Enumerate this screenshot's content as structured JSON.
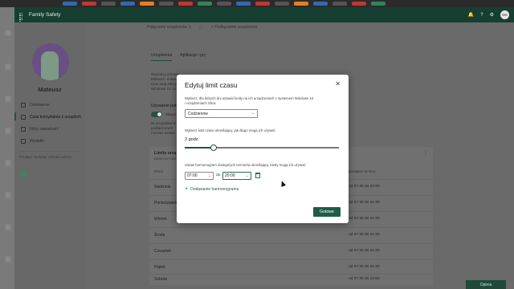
{
  "app": {
    "title": "Family Safety",
    "user_initials": "MS",
    "help_icon": "help-icon",
    "settings_icon": "settings-icon"
  },
  "top_links": {
    "connected": "Połączone urządzenia: 1",
    "connect_device": "+ Podłączanie urządzenia"
  },
  "sidebar": {
    "name": "Mateusz",
    "items": [
      {
        "label": "Omówienie",
        "icon": "overview-icon"
      },
      {
        "label": "Czas korzystania z urządzeń",
        "icon": "screen-time-icon"
      },
      {
        "label": "Filtry zawartości",
        "icon": "filter-icon"
      },
      {
        "label": "Wydatki",
        "icon": "spending-icon"
      }
    ],
    "note": "Przyłącz na swoje członka rodziny"
  },
  "tabs": [
    "Urządzenia",
    "Aplikacje i gry"
  ],
  "background_text": {
    "p1": "Wypracuj zdrowe\nMateusz. Zobacz\nczas tutaj zdecyd\nWindows 10 i ko",
    "using_one": "Używanie jednego",
    "toggle_label": "Włączone",
    "p2": "W przypadku w\npodłączonych\nmożesz ustawi"
  },
  "limits_card": {
    "title": "Limity urzą",
    "subtitle": "DESKTOP-0ZZ",
    "col_day": "Dzień",
    "col_avail": "Dostępne terminy",
    "rows": [
      {
        "day": "Niedziela",
        "range": "od 07:30 do 22:00"
      },
      {
        "day": "Poniedziałek",
        "range": "od 07:30 do 21:30"
      },
      {
        "day": "Wtorek",
        "range": "od 07:30 do 21:30"
      },
      {
        "day": "Środa",
        "range": "od 07:30 do 21:30"
      },
      {
        "day": "Czwartek",
        "range": "od 07:30 do 21:30"
      },
      {
        "day": "Piątek",
        "range": "od 07:30 do 21:30"
      },
      {
        "day": "Sobota",
        "range": "od 07:30 do 22:00"
      }
    ]
  },
  "feedback_button": "Opinia",
  "modal": {
    "title": "Edytuj limit czasu",
    "desc_days": "Wybierz, dla których dni ustawić limity na ich urządzeniach z systemem Windows 10\ni urządzeniach Xbox",
    "days_select": "Codziennie",
    "desc_duration": "Wybierz limit czasu określający, jak długo mogą ich używać",
    "duration": "2 godz.",
    "duration_fraction": 0.19,
    "desc_schedule": "Ustaw harmonogram dostępnych terminów określający, kiedy mogą ich używać",
    "from_time": "07:00",
    "to_label": "do",
    "to_time": "20:00",
    "add_schedule": "Dodawanie harmonogramu",
    "done": "Gotowe"
  },
  "colors": {
    "accent": "#1f5c46",
    "header": "#173f31"
  }
}
